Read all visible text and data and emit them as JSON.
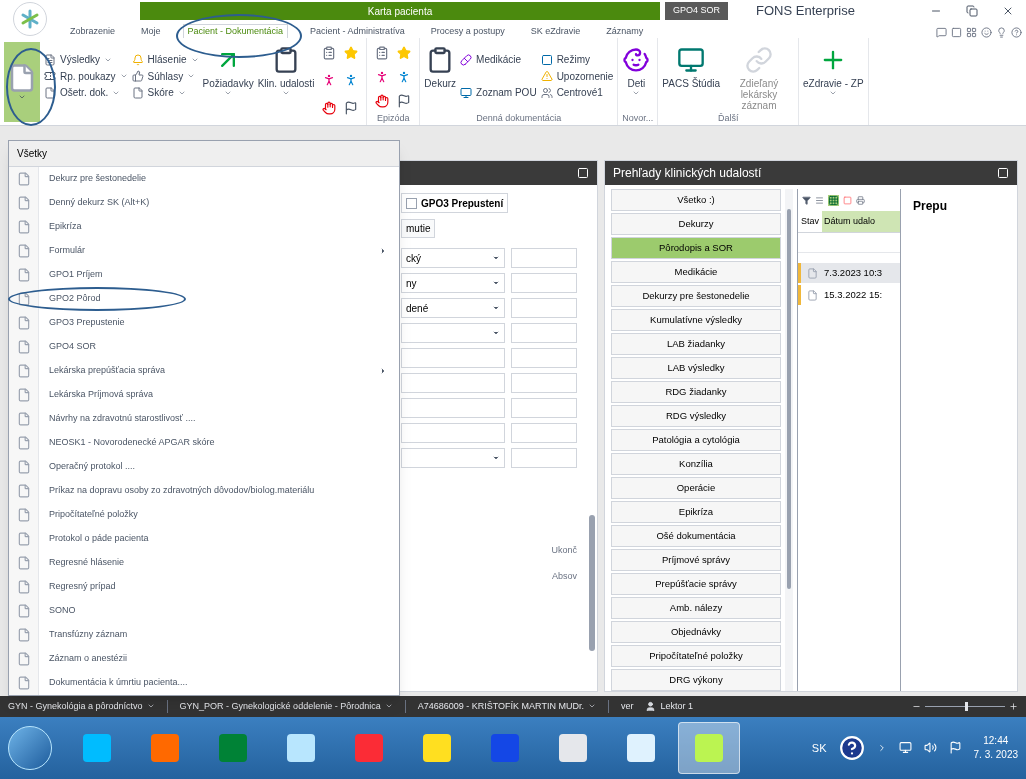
{
  "title_bar": {
    "app_tab": "Karta pacienta",
    "document_tab": "GPO4 SOR",
    "app_name": "FONS Enterprise"
  },
  "ribbon_tabs": [
    {
      "label": "Zobrazenie",
      "selected": false
    },
    {
      "label": "Moje",
      "selected": false
    },
    {
      "label": "Pacient - Dokumentácia",
      "selected": true
    },
    {
      "label": "Pacient - Administratíva",
      "selected": false
    },
    {
      "label": "Procesy a postupy",
      "selected": false
    },
    {
      "label": "SK eZdravie",
      "selected": false
    },
    {
      "label": "Záznamy",
      "selected": false
    }
  ],
  "ribbon": {
    "groups": [
      {
        "columns": [
          {
            "kind": "new",
            "expanded": true
          },
          {
            "kind": "stack",
            "items": [
              {
                "label": "Výsledky",
                "dropdown": true
              },
              {
                "label": "Rp. poukazy",
                "dropdown": true
              },
              {
                "label": "Ošetr. dok.",
                "dropdown": true
              }
            ]
          },
          {
            "kind": "stack",
            "items": [
              {
                "label": "Hlásenie",
                "dropdown": true
              },
              {
                "label": "Súhlasy",
                "dropdown": true
              },
              {
                "label": "Skóre",
                "dropdown": true
              }
            ]
          },
          {
            "kind": "large",
            "label": "Požiadavky",
            "dropdown": true
          },
          {
            "kind": "large",
            "label": "Klin. udalosti",
            "dropdown": true
          },
          {
            "kind": "icons"
          }
        ]
      },
      {
        "label": "Epizóda",
        "columns": [
          {
            "kind": "icons"
          }
        ]
      },
      {
        "label": "Denná dokumentácia",
        "columns": [
          {
            "kind": "large",
            "label": "Dekurz",
            "dropdown": false
          },
          {
            "kind": "stack",
            "items": [
              {
                "label": "Medikácie",
                "dropdown": false
              },
              {
                "label": "Zoznam POU",
                "dropdown": false
              }
            ]
          },
          {
            "kind": "stack",
            "items": [
              {
                "label": "Režimy",
                "dropdown": false
              },
              {
                "label": "Upozornenie",
                "dropdown": false
              },
              {
                "label": "Centrové1",
                "dropdown": false
              }
            ]
          }
        ]
      },
      {
        "label": "Novor...",
        "columns": [
          {
            "kind": "large",
            "label": "Deti",
            "dropdown": true
          }
        ]
      },
      {
        "label": "Ďalší",
        "columns": [
          {
            "kind": "large",
            "label": "PACS Štúdia",
            "dropdown": false
          },
          {
            "kind": "large",
            "label": "Zdieľaný lekársky záznam",
            "dropdown": false,
            "disabled": true
          }
        ]
      },
      {
        "columns": [
          {
            "kind": "large",
            "label": "eZdravie - ZP",
            "dropdown": true
          }
        ]
      }
    ]
  },
  "menu": {
    "header": "Všetky",
    "items": [
      {
        "label": "Dekurz pre šestonedelie",
        "submenu": false
      },
      {
        "label": "Denný dekurz SK (Alt+K)",
        "submenu": false
      },
      {
        "label": "Epikríza",
        "submenu": false
      },
      {
        "label": "Formulár",
        "submenu": true
      },
      {
        "label": "GPO1 Príjem",
        "submenu": false
      },
      {
        "label": "GPO2 Pôrod",
        "submenu": false
      },
      {
        "label": "GPO3 Prepustenie",
        "submenu": false
      },
      {
        "label": "GPO4 SOR",
        "submenu": false
      },
      {
        "label": "Lekárska prepúšťacia správa",
        "submenu": true
      },
      {
        "label": "Lekárska Príjmová správa",
        "submenu": false
      },
      {
        "label": "Návrhy na zdravotnú starostlivosť ....",
        "submenu": false
      },
      {
        "label": "NEOSK1 - Novorodenecké APGAR skóre",
        "submenu": false
      },
      {
        "label": "Operačný protokol ....",
        "submenu": false
      },
      {
        "label": "Príkaz na dopravu osoby zo zdravotných dôvodov/biolog.materiálu",
        "submenu": false
      },
      {
        "label": "Pripočítateľné položky",
        "submenu": false
      },
      {
        "label": "Protokol o páde pacienta",
        "submenu": false
      },
      {
        "label": "Regresné hlásenie",
        "submenu": false
      },
      {
        "label": "Regresný prípad",
        "submenu": false
      },
      {
        "label": "SONO",
        "submenu": false
      },
      {
        "label": "Transfúzny záznam",
        "submenu": false
      },
      {
        "label": "Záznam o anestézii",
        "submenu": false
      },
      {
        "label": "Dokumentácia k úmrtiu pacienta....",
        "submenu": false
      }
    ]
  },
  "form_panel": {
    "tab": {
      "label": "GPO3 Prepustení",
      "checked": false
    },
    "button": "mutie",
    "rows": [
      {
        "kind": "select",
        "value": "cký"
      },
      {
        "kind": "select",
        "value": "ny"
      },
      {
        "kind": "select",
        "value": "dené"
      },
      {
        "kind": "select"
      },
      {
        "kind": "text"
      },
      {
        "kind": "text"
      },
      {
        "kind": "text"
      },
      {
        "kind": "text"
      },
      {
        "kind": "select"
      }
    ],
    "labels": [
      "Ukonč",
      "Absov"
    ]
  },
  "events_panel": {
    "title": "Prehľady klinických udalostí",
    "categories": [
      {
        "label": "Všetko :)",
        "selected": false
      },
      {
        "label": "Dekurzy",
        "selected": false
      },
      {
        "label": "Pôrodopis a SOR",
        "selected": true
      },
      {
        "label": "Medikácie",
        "selected": false
      },
      {
        "label": "Dekurzy pre šestonedelie",
        "selected": false
      },
      {
        "label": "Kumulatívne výsledky",
        "selected": false
      },
      {
        "label": "LAB žiadanky",
        "selected": false
      },
      {
        "label": "LAB výsledky",
        "selected": false
      },
      {
        "label": "RDG žiadanky",
        "selected": false
      },
      {
        "label": "RDG výsledky",
        "selected": false
      },
      {
        "label": "Patológia a cytológia",
        "selected": false
      },
      {
        "label": "Konzília",
        "selected": false
      },
      {
        "label": "Operácie",
        "selected": false
      },
      {
        "label": "Epikríza",
        "selected": false
      },
      {
        "label": "Ošé dokumentácia",
        "selected": false
      },
      {
        "label": "Príjmové správy",
        "selected": false
      },
      {
        "label": "Prepúšťacie správy",
        "selected": false
      },
      {
        "label": "Amb. nálezy",
        "selected": false
      },
      {
        "label": "Objednávky",
        "selected": false
      },
      {
        "label": "Pripočítateľné položky",
        "selected": false
      },
      {
        "label": "DRG výkony",
        "selected": false
      }
    ],
    "table": {
      "columns": [
        "Stav",
        "Dátum udalo"
      ],
      "rows": [
        {
          "date": "7.3.2023 10:3",
          "selected": true
        },
        {
          "date": "15.3.2022 15:",
          "selected": false
        }
      ]
    },
    "detail_title": "Prepu"
  },
  "status_bar": {
    "items": [
      "GYN - Gynekológia a pôrodníctvo",
      "GYN_POR - Gynekologické oddelenie - Pôrodnica",
      "A74686009 - KRIŠTOFÍK MARTIN MUDr."
    ],
    "version": "ver",
    "user": "Lektor 1",
    "zoom": {
      "level": 0.5
    }
  },
  "taskbar": {
    "apps": [
      {
        "selected": false
      },
      {
        "selected": false
      },
      {
        "selected": false
      },
      {
        "selected": false
      },
      {
        "selected": false
      },
      {
        "selected": false
      },
      {
        "selected": false
      },
      {
        "selected": false
      },
      {
        "selected": false
      },
      {
        "selected": true
      }
    ],
    "language": "SK",
    "time": "12:44",
    "date": "7. 3. 2023"
  }
}
